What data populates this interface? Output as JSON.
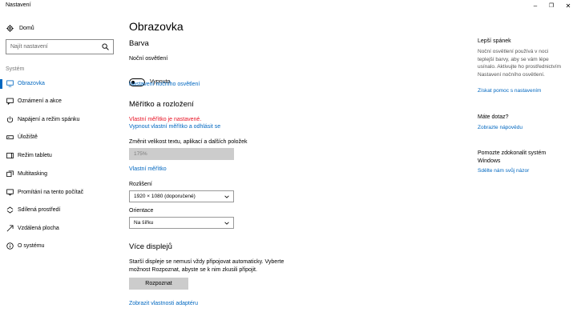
{
  "window": {
    "title": "Nastavení",
    "controls": {
      "minimize": "–",
      "maximize": "❐",
      "close": "✕"
    }
  },
  "sidebar": {
    "home_label": "Domů",
    "search_placeholder": "Najít nastavení",
    "section_label": "Systém",
    "items": [
      {
        "label": "Obrazovka",
        "icon": "monitor-icon",
        "active": true
      },
      {
        "label": "Oznámení a akce",
        "icon": "notification-icon"
      },
      {
        "label": "Napájení a režim spánku",
        "icon": "power-icon"
      },
      {
        "label": "Úložiště",
        "icon": "storage-icon"
      },
      {
        "label": "Režim tabletu",
        "icon": "tablet-icon"
      },
      {
        "label": "Multitasking",
        "icon": "multitasking-icon"
      },
      {
        "label": "Promítání na tento počítač",
        "icon": "projection-icon"
      },
      {
        "label": "Sdílená prostředí",
        "icon": "shared-experiences-icon"
      },
      {
        "label": "Vzdálená plocha",
        "icon": "remote-desktop-icon"
      },
      {
        "label": "O systému",
        "icon": "info-icon"
      }
    ]
  },
  "main": {
    "title": "Obrazovka",
    "color": {
      "heading": "Barva",
      "night_light_label": "Noční osvětlení",
      "toggle_state": "Vypnuto",
      "settings_link": "Nastavení nočního osvětlení"
    },
    "scale": {
      "heading": "Měřítko a rozložení",
      "custom_warning": "Vlastní měřítko je nastavené.",
      "turn_off_link": "Vypnout vlastní měřítko a odhlásit se",
      "text_size_label": "Změnit velikost textu, aplikací a dalších položek",
      "text_size_value": "175%",
      "custom_scale_link": "Vlastní měřítko",
      "resolution_label": "Rozlišení",
      "resolution_value": "1920 × 1080 (doporučené)",
      "orientation_label": "Orientace",
      "orientation_value": "Na šířku"
    },
    "multi": {
      "heading": "Více displejů",
      "description_line1": "Starší displeje se nemusí vždy připojovat automaticky. Vyberte",
      "description_line2": "možnost Rozpoznat, abyste se k nim zkusili připojit.",
      "detect_button": "Rozpoznat",
      "adapter_link": "Zobrazit vlastnosti adaptéru"
    }
  },
  "right_panel": {
    "sleep_heading": "Lepší spánek",
    "sleep_text": "Noční osvětlení používá v noci teplejší barvy, aby se vám lépe usínalo. Aktivujte ho prostřednictvím Nastavení nočního osvětlení.",
    "sleep_link": "Získat pomoc s nastavením",
    "question_heading": "Máte dotaz?",
    "help_link": "Zobrazte nápovědu",
    "improve_heading": "Pomozte zdokonalit systém Windows",
    "feedback_link": "Sdělte nám svůj názor"
  },
  "colors": {
    "accent": "#0067c0",
    "warning": "#e81123",
    "button_bg": "#cccccc"
  }
}
